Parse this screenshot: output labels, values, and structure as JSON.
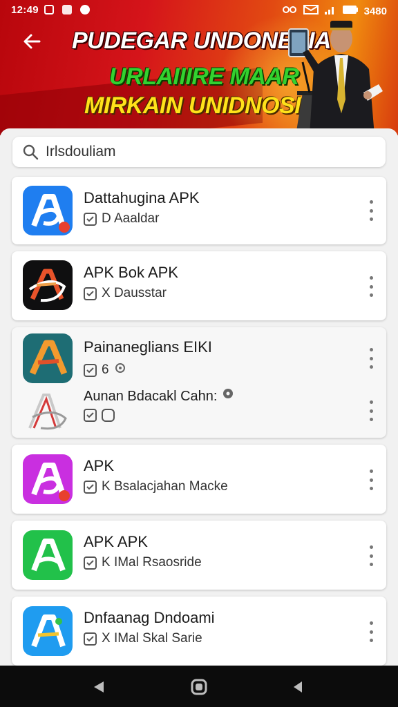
{
  "status_bar": {
    "time": "12:49",
    "battery_text": "3480"
  },
  "header": {
    "title_line1": "PUDEGAR UNDONESIA",
    "title_line2": "URLAIIIRE MAAR",
    "title_line3": "MIRKAIN UNIDNOSII!"
  },
  "search": {
    "value": "Irlsdouliam"
  },
  "apps": [
    {
      "name": "Dattahugina APK",
      "sub": "D Aaaldar"
    },
    {
      "name": "APK Bok APK",
      "sub": "X Dausstar"
    },
    {
      "name": "Painaneglians EIKI",
      "sub": "6",
      "sub2": "Aunan Bdacakl Cahn:"
    },
    {
      "name": "APK",
      "sub": "K Bsalacjahan Macke"
    },
    {
      "name": "APK APK",
      "sub": "K IMal Rsaosride"
    },
    {
      "name": "Dnfaanag Dndoami",
      "sub": "X IMal Skal Sarie"
    }
  ],
  "colors": {
    "banner_red": "#d5141a",
    "banner_orange": "#f08a0f",
    "title_green": "#33d12f",
    "title_yellow": "#ffe21a",
    "nav_bg": "#0c0c0c"
  },
  "icons": [
    "back-arrow-icon",
    "search-icon",
    "more-vert-icon",
    "check-icon",
    "nav-back-icon",
    "nav-home-icon",
    "nav-recents-icon"
  ]
}
